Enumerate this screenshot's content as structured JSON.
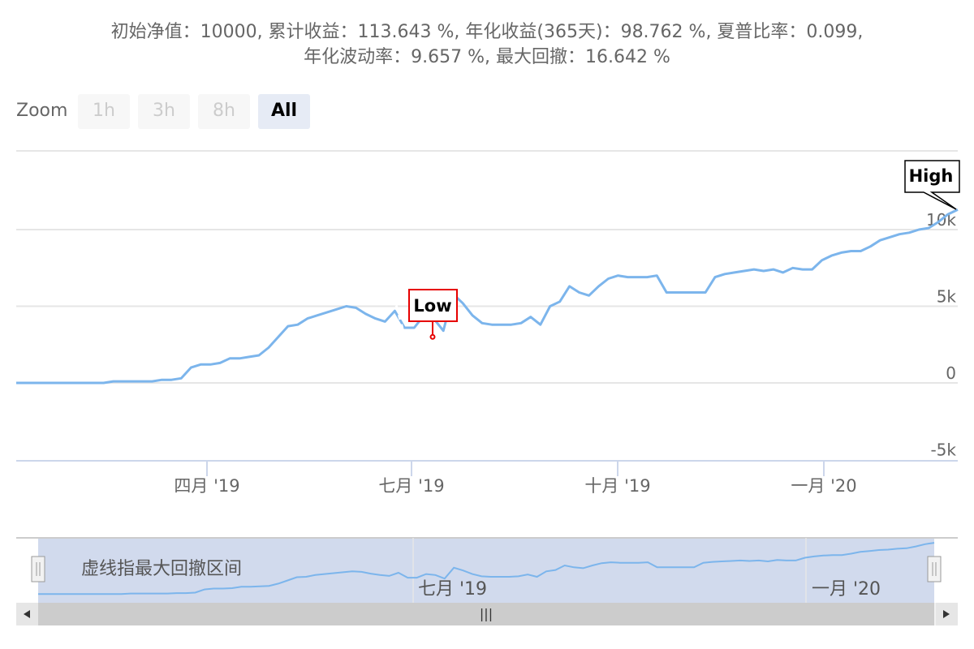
{
  "subtitle": {
    "line1": "初始净值：10000, 累计收益：113.643 %, 年化收益(365天)：98.762 %, 夏普比率：0.099,",
    "line2": "年化波动率：9.657 %, 最大回撤：16.642 %"
  },
  "zoom": {
    "label": "Zoom",
    "buttons": [
      "1h",
      "3h",
      "8h",
      "All"
    ],
    "selected": "All"
  },
  "navigator": {
    "label": "虚线指最大回撤区间",
    "x_ticks": [
      "七月 '19",
      "一月 '20"
    ],
    "scrollbar_grip": "|||"
  },
  "flags": {
    "high": "High",
    "low": "Low"
  },
  "colors": {
    "line": "#7cb5ec",
    "low_marker": "#e60000",
    "navigator_mask": "rgba(102,133,194,0.3)",
    "grid": "#e6e6e6"
  },
  "chart_data": {
    "type": "line",
    "series": [
      {
        "values": [
          0,
          0,
          0,
          0,
          0,
          0,
          0,
          0,
          0,
          0,
          100,
          100,
          100,
          100,
          100,
          200,
          200,
          300,
          1000,
          1200,
          1200,
          1300,
          1600,
          1600,
          1700,
          1800,
          2300,
          3000,
          3700,
          3800,
          4200,
          4400,
          4600,
          4800,
          5000,
          4900,
          4500,
          4200,
          4000,
          4700,
          3600,
          3600,
          4400,
          4200,
          3400,
          5800,
          5200,
          4400,
          3900,
          3800,
          3800,
          3800,
          3900,
          4300,
          3800,
          5000,
          5300,
          6300,
          5900,
          5700,
          6300,
          6800,
          7000,
          6900,
          6900,
          6900,
          7000,
          5900,
          5900,
          5900,
          5900,
          5900,
          6900,
          7100,
          7200,
          7300,
          7400,
          7300,
          7400,
          7200,
          7500,
          7400,
          7400,
          8000,
          8300,
          8500,
          8600,
          8600,
          8900,
          9300,
          9500,
          9700,
          9800,
          10000,
          10100,
          10500,
          11000,
          11300
        ],
        "low": 3000,
        "high": 11300
      }
    ],
    "x_ticks": [
      "四月 '19",
      "七月 '19",
      "十月 '19",
      "一月 '20"
    ],
    "y_ticks": [
      "-5k",
      "0",
      "5k",
      "10k"
    ],
    "ylim": [
      -5000,
      10000
    ]
  }
}
